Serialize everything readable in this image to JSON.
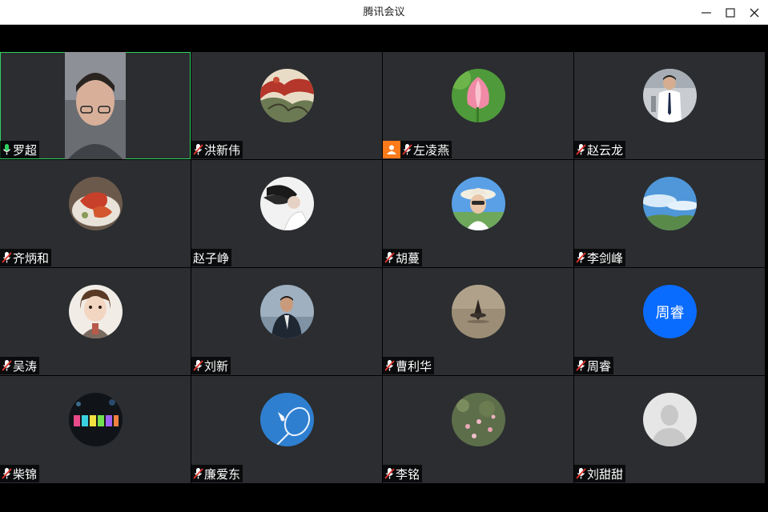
{
  "window": {
    "title": "腾讯会议"
  },
  "participants": [
    {
      "name": "罗超",
      "mic": "active",
      "avatar": "video"
    },
    {
      "name": "洪新伟",
      "mic": "muted",
      "avatar": "painting"
    },
    {
      "name": "左凌燕",
      "mic": "muted",
      "avatar": "lotus",
      "host": true
    },
    {
      "name": "赵云龙",
      "mic": "muted",
      "avatar": "person-shirt"
    },
    {
      "name": "齐炳和",
      "mic": "muted",
      "avatar": "food"
    },
    {
      "name": "赵子峥",
      "mic": "none",
      "avatar": "girl-hair"
    },
    {
      "name": "胡蔓",
      "mic": "muted",
      "avatar": "woman-hat"
    },
    {
      "name": "李剑峰",
      "mic": "muted",
      "avatar": "sky"
    },
    {
      "name": "吴涛",
      "mic": "muted",
      "avatar": "child"
    },
    {
      "name": "刘新",
      "mic": "muted",
      "avatar": "man-suit"
    },
    {
      "name": "曹利华",
      "mic": "muted",
      "avatar": "spinning-top"
    },
    {
      "name": "周睿",
      "mic": "muted",
      "avatar": "text",
      "avatar_text": "周睿"
    },
    {
      "name": "柴锦",
      "mic": "muted",
      "avatar": "happy-lights"
    },
    {
      "name": "廉爱东",
      "mic": "muted",
      "avatar": "badminton"
    },
    {
      "name": "李铭",
      "mic": "muted",
      "avatar": "flowers"
    },
    {
      "name": "刘甜甜",
      "mic": "muted",
      "avatar": "default-person"
    }
  ],
  "colors": {
    "tile_bg": "#2b2d30",
    "active_border": "#2fd160",
    "host_badge": "#ff7a1a",
    "text_avatar": "#0a6cff"
  }
}
